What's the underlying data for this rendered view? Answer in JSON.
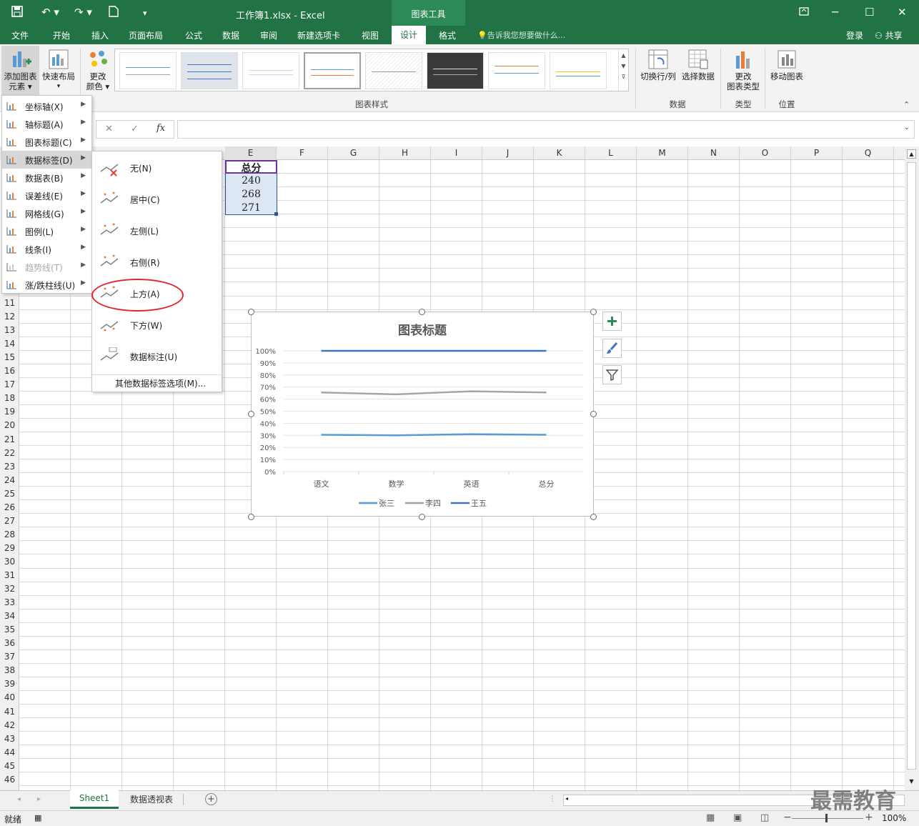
{
  "titlebar": {
    "title": "工作簿1.xlsx - Excel",
    "context_tab": "图表工具",
    "restore_icon": "ribbon-display-icon"
  },
  "tabs": [
    "文件",
    "开始",
    "插入",
    "页面布局",
    "公式",
    "数据",
    "审阅",
    "新建选项卡",
    "视图",
    "设计",
    "格式"
  ],
  "tab_active": "设计",
  "tell_me": "告诉我您想要做什么...",
  "login": "登录",
  "share": "共享",
  "ribbon": {
    "add_element": [
      "添加图表",
      "元素 ▾"
    ],
    "quick_layout": "快速布局",
    "change_color": [
      "更改",
      "颜色 ▾"
    ],
    "styles_group": "图表样式",
    "switch_row_col": "切换行/列",
    "select_data": "选择数据",
    "data_group": "数据",
    "change_type": [
      "更改",
      "图表类型"
    ],
    "type_group": "类型",
    "move_chart": "移动图表",
    "location_group": "位置"
  },
  "formula_bar": {
    "cancel": "✕",
    "enter": "✓",
    "fx": "fx",
    "value": ""
  },
  "columns": [
    "E",
    "F",
    "G",
    "H",
    "I",
    "J",
    "K",
    "L",
    "M",
    "N",
    "O",
    "P",
    "Q"
  ],
  "rows": [
    "11",
    "12",
    "13",
    "14",
    "15",
    "16",
    "17",
    "18",
    "19",
    "20",
    "21",
    "22",
    "23",
    "24",
    "25",
    "26",
    "27",
    "28",
    "29",
    "30",
    "31",
    "32",
    "33",
    "34",
    "35",
    "36",
    "37",
    "38",
    "39",
    "40",
    "41",
    "42",
    "43",
    "44",
    "45",
    "46"
  ],
  "cells": {
    "e_header": "总分",
    "e2": "240",
    "e3": "268",
    "e4": "271"
  },
  "menu1": [
    {
      "label": "坐标轴(X)",
      "state": "normal"
    },
    {
      "label": "轴标题(A)",
      "state": "normal"
    },
    {
      "label": "图表标题(C)",
      "state": "normal"
    },
    {
      "label": "数据标签(D)",
      "state": "hover"
    },
    {
      "label": "数据表(B)",
      "state": "normal"
    },
    {
      "label": "误差线(E)",
      "state": "normal"
    },
    {
      "label": "网格线(G)",
      "state": "normal"
    },
    {
      "label": "图例(L)",
      "state": "normal"
    },
    {
      "label": "线条(I)",
      "state": "normal"
    },
    {
      "label": "趋势线(T)",
      "state": "disabled"
    },
    {
      "label": "涨/跌柱线(U)",
      "state": "normal"
    }
  ],
  "menu2": [
    "无(N)",
    "居中(C)",
    "左侧(L)",
    "右侧(R)",
    "上方(A)",
    "下方(W)",
    "数据标注(U)"
  ],
  "menu2_more": "其他数据标签选项(M)...",
  "chart_data": {
    "type": "line",
    "title": "图表标题",
    "categories": [
      "语文",
      "数学",
      "英语",
      "总分"
    ],
    "y_ticks": [
      "100%",
      "90%",
      "80%",
      "70%",
      "60%",
      "50%",
      "40%",
      "30%",
      "20%",
      "10%",
      "0%"
    ],
    "ylim": [
      0,
      1
    ],
    "series": [
      {
        "name": "张三",
        "values": [
          0.305,
          0.3,
          0.31,
          0.305
        ],
        "color": "#5b9bd5"
      },
      {
        "name": "李四",
        "values": [
          0.655,
          0.64,
          0.665,
          0.655
        ],
        "color": "#a5a5a5"
      },
      {
        "name": "王五",
        "values": [
          1.0,
          1.0,
          1.0,
          1.0
        ],
        "color": "#4472c4"
      }
    ],
    "legend_position": "bottom"
  },
  "sheet_tabs": [
    "Sheet1",
    "数据透视表"
  ],
  "active_sheet": "Sheet1",
  "status": {
    "ready": "就绪",
    "zoom": "100%"
  },
  "watermark": "最需教育"
}
